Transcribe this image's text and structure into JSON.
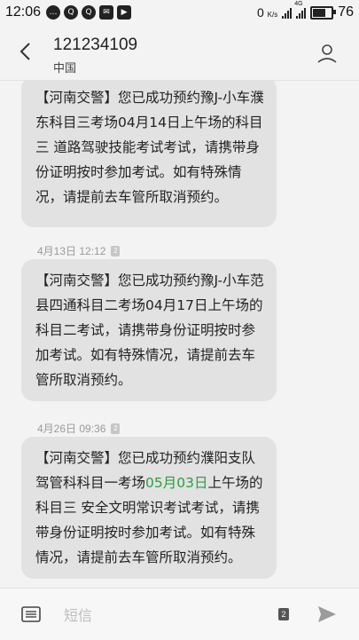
{
  "status_bar": {
    "time": "12:06",
    "network_speed": "0",
    "network_unit": "K/s",
    "signal_label": "4G",
    "battery_level": 0.76,
    "battery_text": "76"
  },
  "header": {
    "contact_number": "121234109",
    "contact_region": "中国"
  },
  "messages": [
    {
      "meta": "",
      "text": "【河南交警】您已成功预约豫J-小车濮东科目三考场04月14日上午场的科目三 道路驾驶技能考试考试，请携带身份证明按时参加考试。如有特殊情况，请提前去车管所取消预约。"
    },
    {
      "meta": "4月13日 12:12",
      "sim": "2",
      "text": "【河南交警】您已成功预约豫J-小车范县四通科目二考场04月17日上午场的科目二考试，请携带身份证明按时参加考试。如有特殊情况，请提前去车管所取消预约。"
    },
    {
      "meta": "4月26日 09:36",
      "sim": "2",
      "text_before": "【河南交警】您已成功预约濮阳支队驾管科科目一考场",
      "text_highlight": "05月03日",
      "text_after": "上午场的科目三 安全文明常识考试考试，请携带身份证明按时参加考试。如有特殊情况，请提前去车管所取消预约。"
    }
  ],
  "input_bar": {
    "placeholder": "短信",
    "sim_slot": "2"
  },
  "colors": {
    "bubble": "#e2e2e2",
    "highlight": "#2a9d3f",
    "background": "#f3f3f3"
  }
}
